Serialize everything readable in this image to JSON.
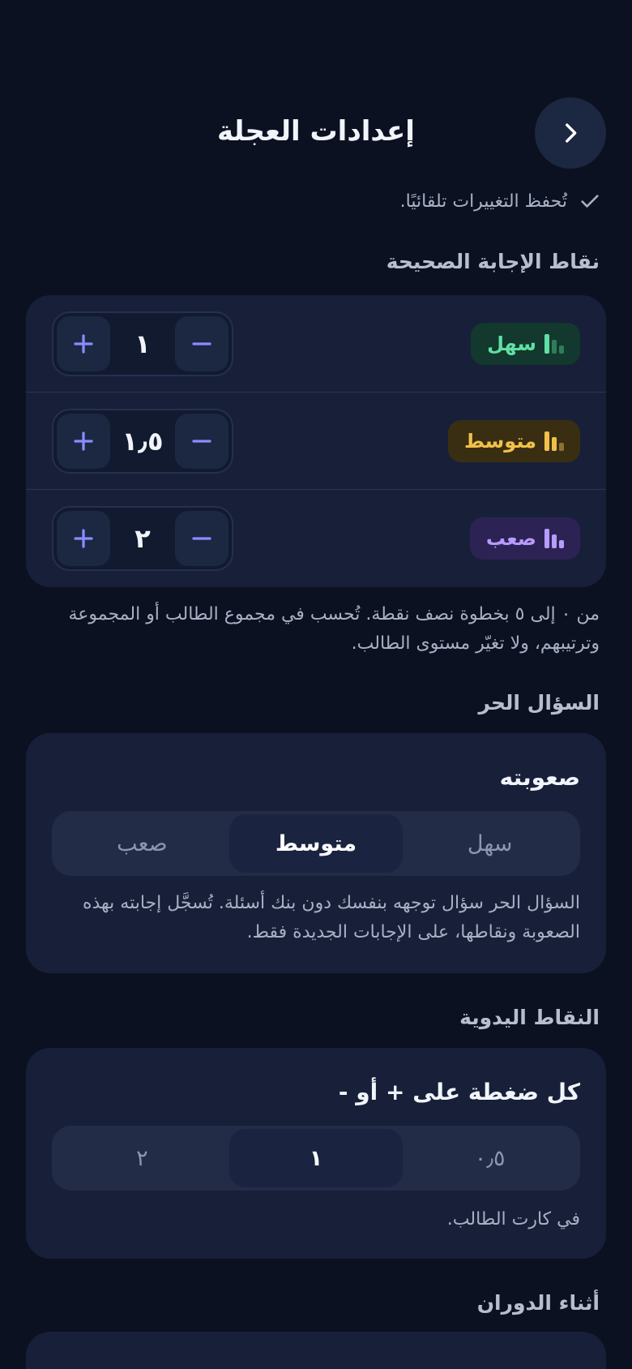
{
  "header": {
    "title": "إعدادات العجلة",
    "back_icon": "chevron-right-icon"
  },
  "autosave": {
    "text": "تُحفظ التغييرات تلقائيًا.",
    "icon": "check-icon"
  },
  "points": {
    "label": "نقاط الإجابة الصحيحة",
    "rows": [
      {
        "difficulty": "سهل",
        "value": "١",
        "color": "#5fe0a4"
      },
      {
        "difficulty": "متوسط",
        "value": "١٫٥",
        "color": "#f0c14a"
      },
      {
        "difficulty": "صعب",
        "value": "٢",
        "color": "#b79bff"
      }
    ],
    "help": "من ٠ إلى ٥ بخطوة نصف نقطة. تُحسب في مجموع الطالب أو المجموعة وترتيبهم، ولا تغيّر مستوى الطالب."
  },
  "free_question": {
    "label": "السؤال الحر",
    "card_title": "صعوبته",
    "options": [
      "سهل",
      "متوسط",
      "صعب"
    ],
    "selected": "متوسط",
    "help": "السؤال الحر سؤال توجهه بنفسك دون بنك أسئلة. تُسجَّل إجابته بهذه الصعوبة ونقاطها، على الإجابات الجديدة فقط."
  },
  "manual_points": {
    "label": "النقاط اليدوية",
    "card_title": "كل ضغطة على + أو -",
    "options": [
      "٠٫٥",
      "١",
      "٢"
    ],
    "selected": "١",
    "help": "في كارت الطالب."
  },
  "during_spin": {
    "label": "أثناء الدوران"
  }
}
